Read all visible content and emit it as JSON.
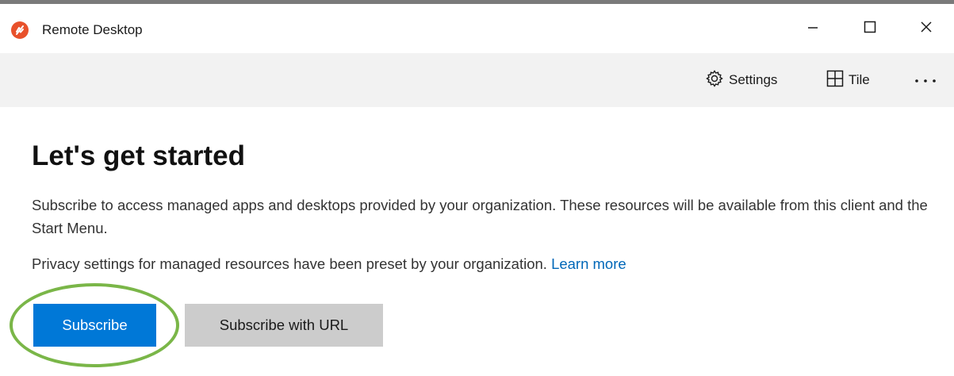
{
  "window": {
    "title": "Remote Desktop",
    "icon": "remote-desktop-app-icon",
    "controls": {
      "minimize_icon": "minimize-icon",
      "maximize_icon": "maximize-icon",
      "close_icon": "close-icon"
    }
  },
  "toolbar": {
    "settings_label": "Settings",
    "settings_icon": "gear-icon",
    "tile_label": "Tile",
    "tile_icon": "grid-icon",
    "more_label": "···",
    "more_icon": "more-icon"
  },
  "main": {
    "heading": "Let's get started",
    "description": "Subscribe to access managed apps and desktops provided by your organization. These resources will be available from this client and the Start Menu.",
    "privacy_text": "Privacy settings for managed resources have been preset by your organization.",
    "learn_more": "Learn more",
    "subscribe_label": "Subscribe",
    "subscribe_url_label": "Subscribe with URL"
  },
  "colors": {
    "accent": "#0078d7",
    "link": "#0067b8",
    "toolbar_bg": "#f2f2f2",
    "secondary_button": "#cccccc",
    "app_icon": "#e8512b",
    "highlight": "#7ab648"
  }
}
